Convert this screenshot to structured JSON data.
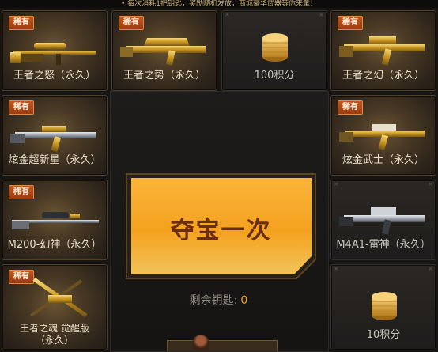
{
  "top_text": "• 每次消耗1把钥匙，奖励随机发放，商城豪华武器等你来拿！",
  "badge_label": "稀有",
  "grid": {
    "left": [
      {
        "label": "王者之怒（永久）",
        "rare": true,
        "icon": "sniper-rifle-gold-icon"
      },
      {
        "label": "炫金超新星（永久）",
        "rare": true,
        "icon": "assault-rifle-gold-icon"
      },
      {
        "label": "M200-幻神（永久）",
        "rare": true,
        "icon": "sniper-rifle-icon"
      },
      {
        "label_line1": "王者之魂 觉醒版",
        "label_line2": "（永久）",
        "rare": true,
        "icon": "crossbow-gold-icon"
      }
    ],
    "top": [
      {
        "label": "王者之势（永久）",
        "rare": true,
        "icon": "assault-rifle-gold-icon"
      },
      {
        "label": "100积分",
        "rare": false,
        "icon": "gold-coin-stack-icon"
      }
    ],
    "right": [
      {
        "label": "王者之幻（永久）",
        "rare": true,
        "icon": "assault-rifle-gold-icon"
      },
      {
        "label": "炫金武士（永久）",
        "rare": true,
        "icon": "assault-rifle-gold-icon"
      },
      {
        "label": "M4A1-雷神（永久）",
        "rare": false,
        "icon": "assault-rifle-silver-icon"
      },
      {
        "label": "10积分",
        "rare": false,
        "icon": "gold-coin-stack-icon"
      }
    ]
  },
  "center": {
    "button_label": "夺宝一次",
    "keys_label": "剩余钥匙:",
    "keys_value": "0"
  },
  "colors": {
    "badge": "#b8481a",
    "button_orange": "#f5a21f",
    "keys_value": "#f0a020",
    "label": "#e8dcc6"
  }
}
